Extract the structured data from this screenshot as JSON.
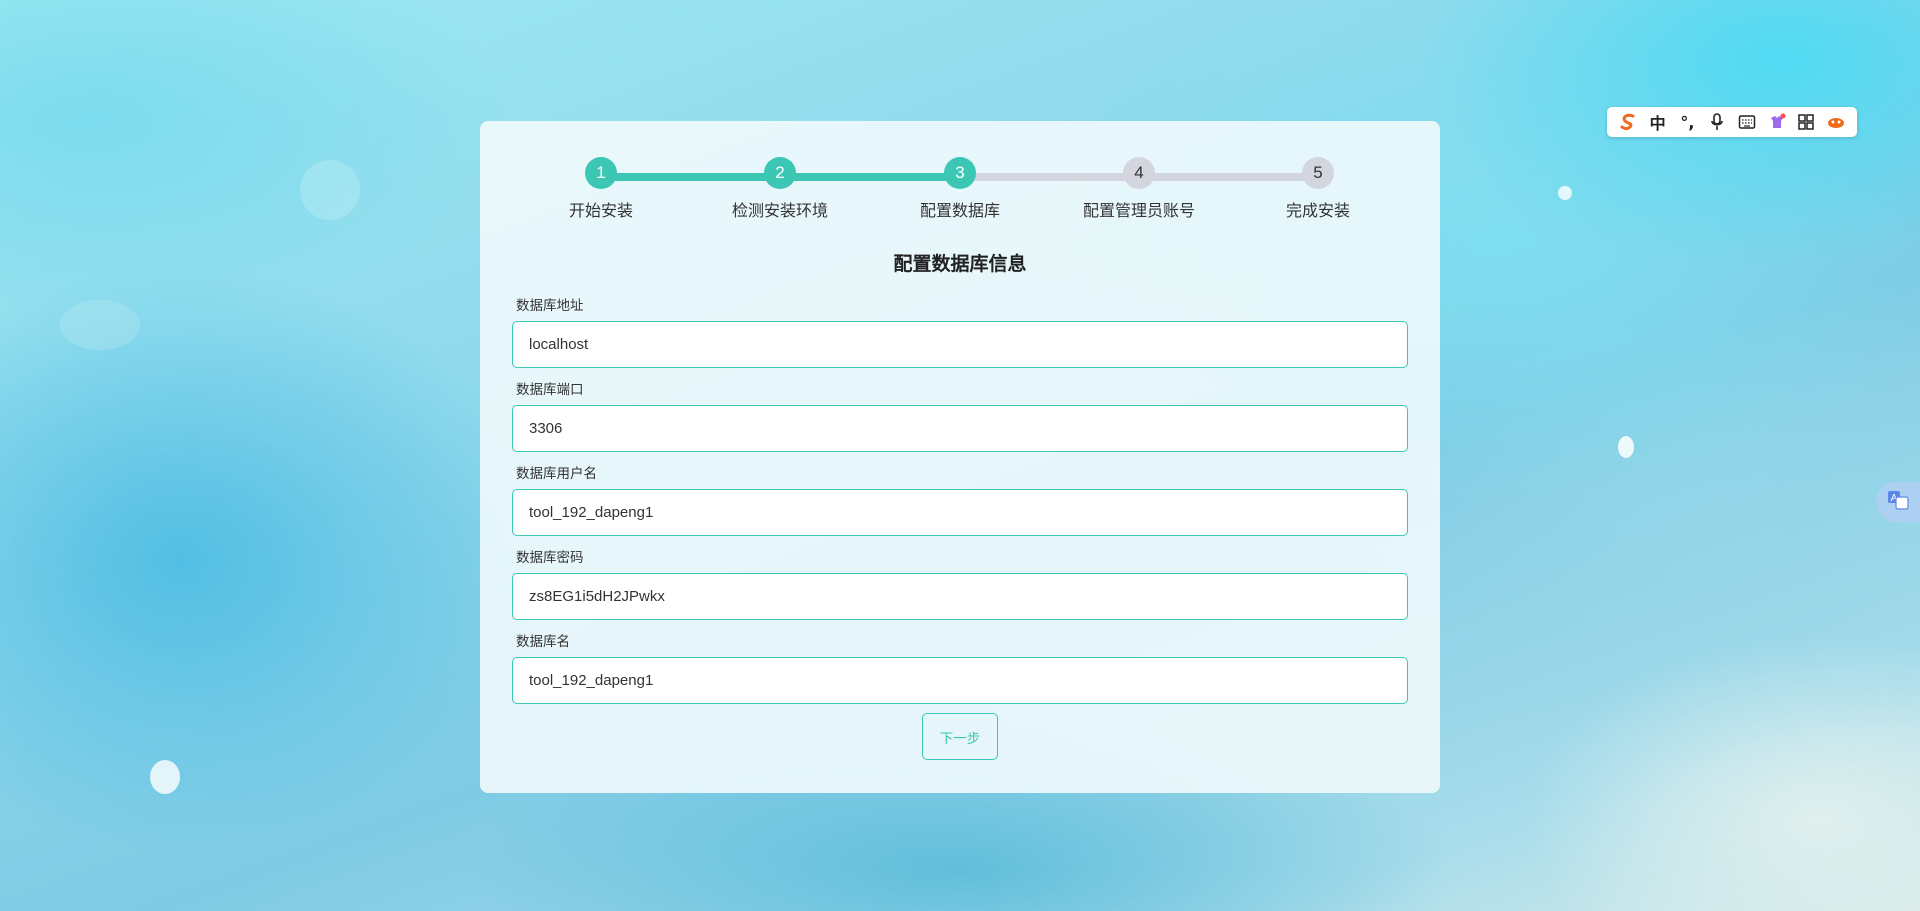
{
  "steps": [
    {
      "number": "1",
      "label": "开始安装",
      "state": "done"
    },
    {
      "number": "2",
      "label": "检测安装环境",
      "state": "done"
    },
    {
      "number": "3",
      "label": "配置数据库",
      "state": "current"
    },
    {
      "number": "4",
      "label": "配置管理员账号",
      "state": "todo"
    },
    {
      "number": "5",
      "label": "完成安装",
      "state": "todo"
    }
  ],
  "form": {
    "title": "配置数据库信息",
    "fields": [
      {
        "label": "数据库地址",
        "value": "localhost"
      },
      {
        "label": "数据库端口",
        "value": "3306"
      },
      {
        "label": "数据库用户名",
        "value": "tool_192_dapeng1"
      },
      {
        "label": "数据库密码",
        "value": "zs8EG1i5dH2JPwkx"
      },
      {
        "label": "数据库名",
        "value": "tool_192_dapeng1"
      }
    ],
    "next_label": "下一步"
  },
  "ime_toolbar": {
    "mode_label": "中",
    "punct_label": "°,",
    "icons": [
      "sogou-logo-icon",
      "microphone-icon",
      "keyboard-icon",
      "skin-icon",
      "grid-apps-icon",
      "mascot-icon"
    ]
  },
  "colors": {
    "accent": "#3cc7b5",
    "inactive": "#d3d6df"
  }
}
